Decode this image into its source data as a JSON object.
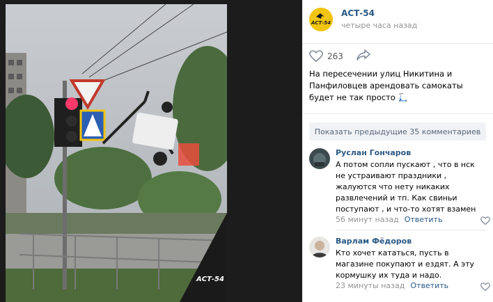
{
  "post": {
    "author_name": "АСТ-54",
    "author_logo_text": "АСТ-54",
    "time": "четыре часа назад",
    "likes": "263",
    "text": "На пересечении улиц Никитина и Панфиловцев арендовать самокаты будет не так просто 🛴",
    "photo_watermark": "АСТ-54"
  },
  "comments": {
    "show_more_label": "Показать предыдущие 35 комментариев",
    "items": [
      {
        "author": "Руслан Гончаров",
        "text": "А потом сопли пускают , что в нск не устраивают праздники , жалуются что нету никаких развлечений и тп. Как свиньи поступают , и что-то хотят взамен",
        "time": "56 минут назад",
        "reply_label": "Ответить"
      },
      {
        "author": "Варлам Фёдоров",
        "text": "Кто хочет кататься, пусть в магазине покупают и ездят. А эту кормушку их туда и надо.",
        "time": "23 минуты назад",
        "reply_label": "Ответить"
      }
    ]
  },
  "colors": {
    "link": "#2a5885",
    "muted": "#939393",
    "logo_bg": "#f1c40f"
  }
}
